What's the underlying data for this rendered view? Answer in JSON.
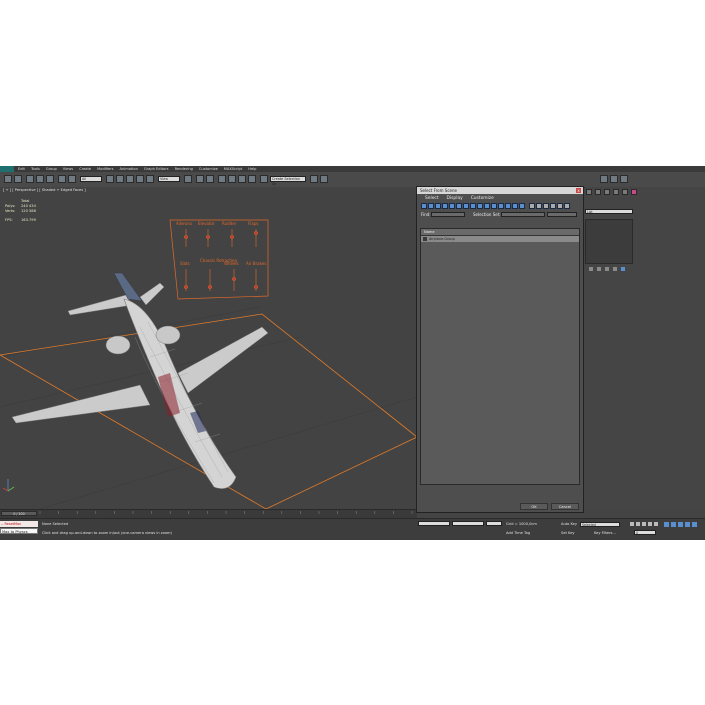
{
  "menubar": {
    "items": [
      "Edit",
      "Tools",
      "Group",
      "Views",
      "Create",
      "Modifiers",
      "Animation",
      "Graph Editors",
      "Rendering",
      "Customize",
      "MAXScript",
      "Help"
    ]
  },
  "toolbar": {
    "selection_filter": "All",
    "reference_coord": "View",
    "named_selection": "Create Selection Se"
  },
  "viewport": {
    "label": "[ + ] [ Perspective ] [ Shaded + Edged Faces ]",
    "stats": {
      "total_label": "Total",
      "polys_label": "Polys:",
      "polys_value": "240 434",
      "verts_label": "Verts:",
      "verts_value": "120 588",
      "fps_label": "FPS:",
      "fps_value": "163.799"
    },
    "rig_labels": [
      "Ailerons",
      "Elevator",
      "Rudder",
      "Flaps",
      "Slats",
      "Chassis Retraction",
      "Wheels",
      "Air Brakes"
    ]
  },
  "dialog": {
    "title": "Select From Scene",
    "close": "x",
    "menu": [
      "Select",
      "Display",
      "Customize"
    ],
    "find_label": "Find:",
    "selection_set_label": "Selection Set:",
    "column_name": "Name",
    "rows": [
      "Airplane-Group"
    ],
    "ok_label": "OK",
    "cancel_label": "Cancel"
  },
  "right_panel": {
    "modifier_list": "List"
  },
  "timeline": {
    "frame_readout": "0 / 100",
    "ticks": [
      "0",
      "5",
      "10",
      "15",
      "20",
      "25",
      "30",
      "35",
      "40",
      "45",
      "50",
      "55",
      "60",
      "65",
      "70",
      "75",
      "80",
      "85",
      "90",
      "95",
      "100"
    ]
  },
  "status": {
    "maxscript_text": "-- ResetMax",
    "welcome_text": "Max to Physcs",
    "selection_text": "None Selected",
    "prompt_text": "Click and drag up-and-down to zoom in/out (one-camera views in zoom)",
    "grid_text": "Grid = 1000,0cm",
    "time_tag_text": "Add Time Tag",
    "auto_key": "Auto Key",
    "set_key": "Set Key",
    "selected_label": "Selected",
    "key_filters": "Key Filters...",
    "frame_field": "0"
  },
  "colors": {
    "viewport_bg": "#434343",
    "rig_orange": "#e06a2a",
    "selection_box": "#e07b2a",
    "dialog_icon": "#5a8fcf"
  }
}
